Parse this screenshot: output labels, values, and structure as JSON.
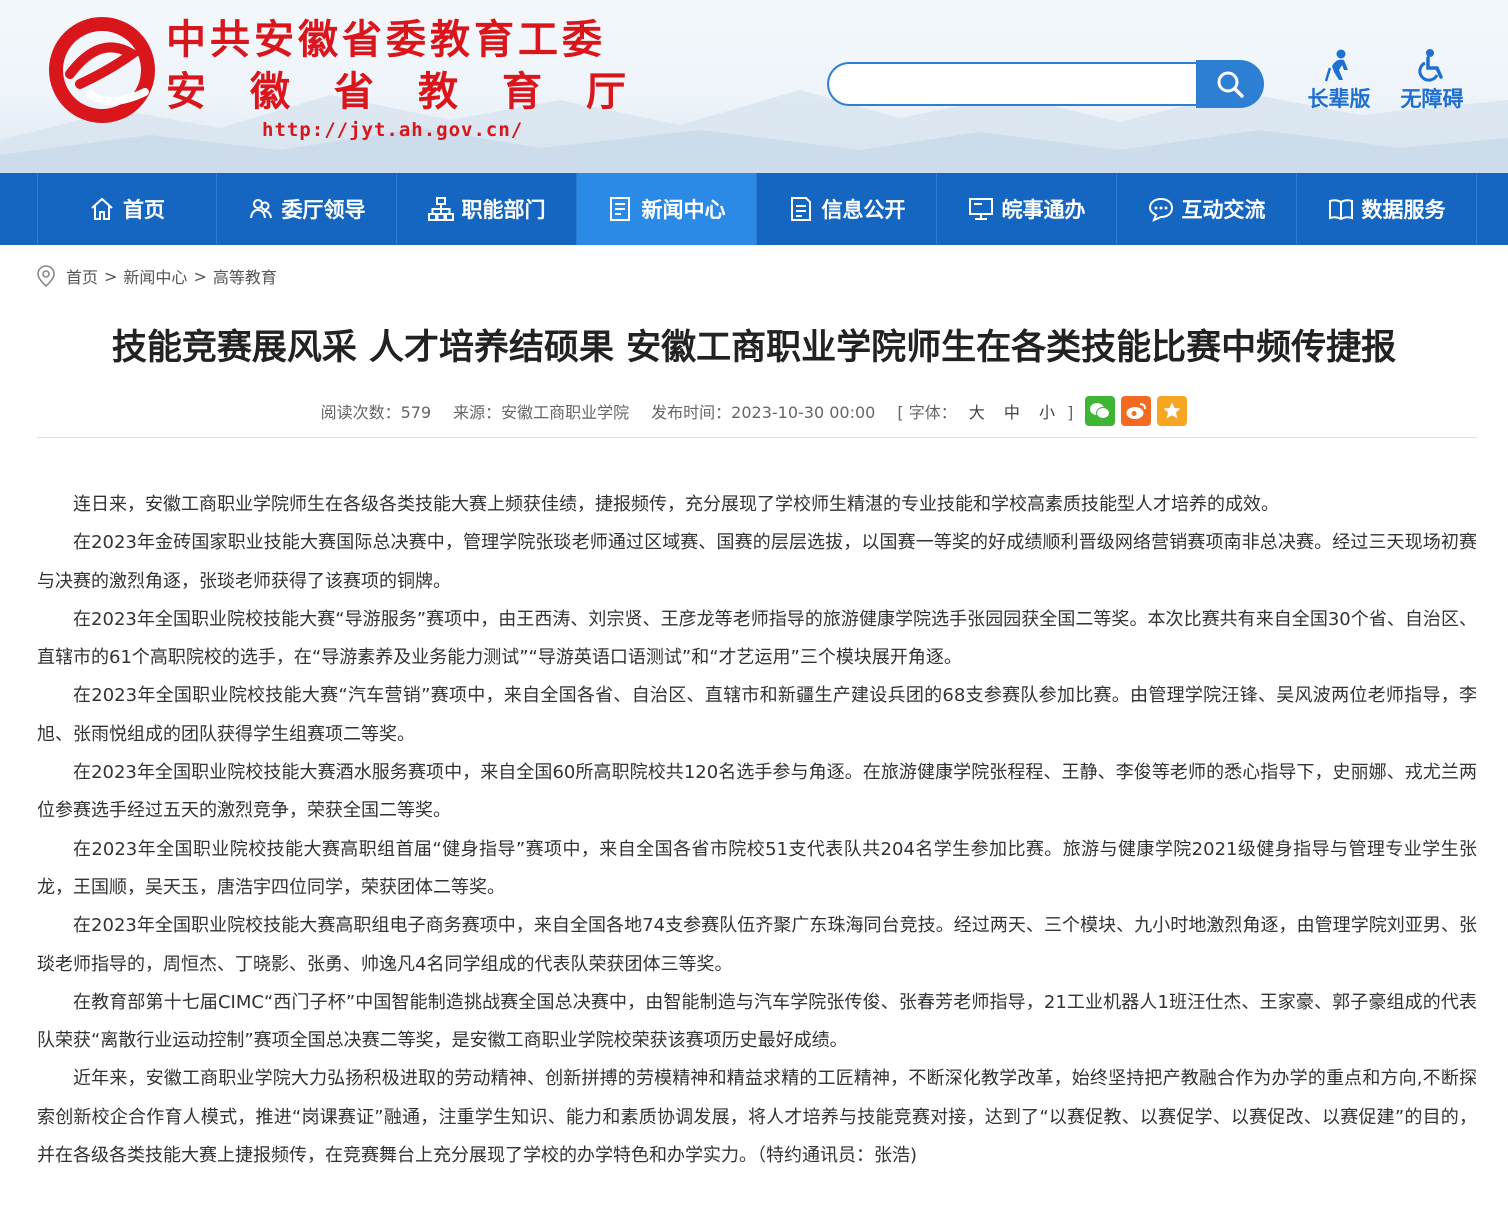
{
  "header": {
    "org_line1": "中共安徽省委教育工委",
    "org_line2": [
      "安",
      "徽",
      "省",
      "教",
      "育",
      "厅"
    ],
    "url": "http://jyt.ah.gov.cn/",
    "search_placeholder": "",
    "tools": [
      {
        "label": "长辈版",
        "icon": "elder-icon"
      },
      {
        "label": "无障碍",
        "icon": "accessibility-icon"
      }
    ],
    "colors": {
      "brand_red": "#d9161c",
      "accent_blue": "#1566c1"
    }
  },
  "nav": {
    "items": [
      {
        "label": "首页",
        "icon": "home-icon"
      },
      {
        "label": "委厅领导",
        "icon": "leaders-icon"
      },
      {
        "label": "职能部门",
        "icon": "org-chart-icon"
      },
      {
        "label": "新闻中心",
        "icon": "news-icon",
        "active": true
      },
      {
        "label": "信息公开",
        "icon": "document-icon"
      },
      {
        "label": "皖事通办",
        "icon": "monitor-icon"
      },
      {
        "label": "互动交流",
        "icon": "chat-icon"
      },
      {
        "label": "数据服务",
        "icon": "book-icon"
      }
    ]
  },
  "breadcrumb": {
    "items": [
      "首页",
      "新闻中心",
      "高等教育"
    ],
    "separator": ">"
  },
  "article": {
    "title": "技能竞赛展风采 人才培养结硕果 安徽工商职业学院师生在各类技能比赛中频传捷报",
    "views": "阅读次数：579",
    "source": "来源：安徽工商职业学院",
    "published": "发布时间：2023-10-30 00:00",
    "font_label_open": "[ 字体：",
    "font_sizes": [
      "大",
      "中",
      "小"
    ],
    "font_label_close": "]",
    "share": [
      "wechat-icon",
      "weibo-icon",
      "favorite-icon"
    ],
    "paragraphs": [
      "连日来，安徽工商职业学院师生在各级各类技能大赛上频获佳绩，捷报频传，充分展现了学校师生精湛的专业技能和学校高素质技能型人才培养的成效。",
      "在2023年金砖国家职业技能大赛国际总决赛中，管理学院张琰老师通过区域赛、国赛的层层选拔，以国赛一等奖的好成绩顺利晋级网络营销赛项南非总决赛。经过三天现场初赛与决赛的激烈角逐，张琰老师获得了该赛项的铜牌。",
      "在2023年全国职业院校技能大赛“导游服务”赛项中，由王西涛、刘宗贤、王彦龙等老师指导的旅游健康学院选手张园园获全国二等奖。本次比赛共有来自全国30个省、自治区、直辖市的61个高职院校的选手，在“导游素养及业务能力测试”“导游英语口语测试”和“才艺运用”三个模块展开角逐。",
      "在2023年全国职业院校技能大赛“汽车营销”赛项中，来自全国各省、自治区、直辖市和新疆生产建设兵团的68支参赛队参加比赛。由管理学院汪锋、吴风波两位老师指导，李旭、张雨悦组成的团队获得学生组赛项二等奖。",
      "在2023年全国职业院校技能大赛酒水服务赛项中，来自全国60所高职院校共120名选手参与角逐。在旅游健康学院张程程、王静、李俊等老师的悉心指导下，史丽娜、戎尤兰两位参赛选手经过五天的激烈竞争，荣获全国二等奖。",
      "在2023年全国职业院校技能大赛高职组首届“健身指导”赛项中，来自全国各省市院校51支代表队共204名学生参加比赛。旅游与健康学院2021级健身指导与管理专业学生张龙，王国顺，吴天玉，唐浩宇四位同学，荣获团体二等奖。",
      "在2023年全国职业院校技能大赛高职组电子商务赛项中，来自全国各地74支参赛队伍齐聚广东珠海同台竞技。经过两天、三个模块、九小时地激烈角逐，由管理学院刘亚男、张琰老师指导的，周恒杰、丁晓影、张勇、帅逸凡4名同学组成的代表队荣获团体三等奖。",
      "在教育部第十七届CIMC“西门子杯”中国智能制造挑战赛全国总决赛中，由智能制造与汽车学院张传俊、张春芳老师指导，21工业机器人1班汪仕杰、王家豪、郭子豪组成的代表队荣获“离散行业运动控制”赛项全国总决赛二等奖，是安徽工商职业学院校荣获该赛项历史最好成绩。",
      "近年来，安徽工商职业学院大力弘扬积极进取的劳动精神、创新拼搏的劳模精神和精益求精的工匠精神，不断深化教学改革，始终坚持把产教融合作为办学的重点和方向,不断探索创新校企合作育人模式，推进“岗课赛证”融通，注重学生知识、能力和素质协调发展，将人才培养与技能竞赛对接，达到了“以赛促教、以赛促学、以赛促改、以赛促建”的目的，并在各级各类技能大赛上捷报频传，在竞赛舞台上充分展现了学校的办学特色和办学实力。（特约通讯员：张浩)"
    ]
  }
}
